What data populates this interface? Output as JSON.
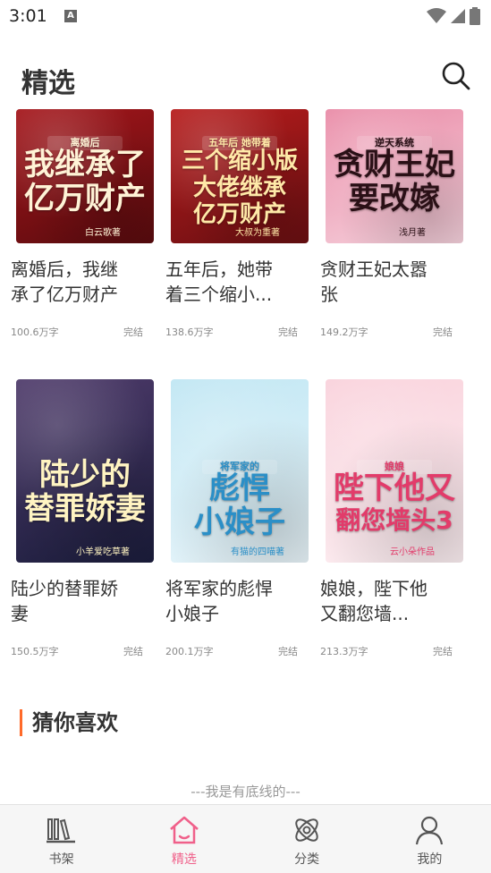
{
  "status_bar": {
    "time": "3:01",
    "notification_icon": "A"
  },
  "header": {
    "title": "精选"
  },
  "books": [
    {
      "title": "离婚后，我继承了亿万财产",
      "title_display": "离婚后，我继\n承了亿万财产",
      "words": "100.6万字",
      "status": "完结",
      "cover": {
        "tag": "离婚后",
        "line1": "我继承了",
        "line2": "亿万财产",
        "author": "白云歌著",
        "bg1": "#5a0b0e",
        "bg2": "#a5161b",
        "fg": "#fff3d6"
      }
    },
    {
      "title": "五年后，她带着三个缩小...",
      "title_display": "五年后，她带\n着三个缩小...",
      "words": "138.6万字",
      "status": "完结",
      "cover": {
        "tag": "五年后 她带着",
        "line1": "三个缩小版",
        "line2": "大佬继承",
        "line3": "亿万财产",
        "author": "大叔为重著",
        "bg1": "#6b0f12",
        "bg2": "#b71c1c",
        "fg": "#ffe9a8"
      }
    },
    {
      "title": "贪财王妃太嚣张",
      "title_display": "贪财王妃太嚣\n张",
      "words": "149.2万字",
      "status": "完结",
      "cover": {
        "tag": "逆天系统",
        "line1": "贪财王妃",
        "line2": "要改嫁",
        "author": "浅月著",
        "bg1": "#f6d2dd",
        "bg2": "#e98aa6",
        "fg": "#2a1016"
      }
    },
    {
      "title": "陆少的替罪娇妻",
      "title_display": "陆少的替罪娇\n妻",
      "words": "150.5万字",
      "status": "完结",
      "cover": {
        "tag": "",
        "line1": "陆少的",
        "line2": "替罪娇妻",
        "author": "小羊爱吃草著",
        "bg1": "#1b1d3d",
        "bg2": "#4f3b6b",
        "fg": "#fff4c2"
      }
    },
    {
      "title": "将军家的彪悍小娘子",
      "title_display": "将军家的彪悍\n小娘子",
      "words": "200.1万字",
      "status": "完结",
      "cover": {
        "tag": "将军家的",
        "line1": "彪悍",
        "line2": "小娘子",
        "author": "有猫的四喵著",
        "bg1": "#eaf6fb",
        "bg2": "#bfe6f3",
        "fg": "#2b8fc7"
      }
    },
    {
      "title": "娘娘，陛下他又翻您墙...",
      "title_display": "娘娘，陛下他\n又翻您墙...",
      "words": "213.3万字",
      "status": "完结",
      "cover": {
        "tag": "娘娘",
        "line1": "陛下他又",
        "line2": "翻您墙头3",
        "author": "云小朵作品",
        "bg1": "#fdf0f3",
        "bg2": "#f9d1db",
        "fg": "#e23b6a"
      }
    }
  ],
  "section": {
    "title": "猜你喜欢"
  },
  "footer_note": "---我是有底线的---",
  "tabs": [
    {
      "label": "书架",
      "icon": "bookshelf-icon",
      "active": false
    },
    {
      "label": "精选",
      "icon": "home-icon",
      "active": true
    },
    {
      "label": "分类",
      "icon": "category-icon",
      "active": false
    },
    {
      "label": "我的",
      "icon": "profile-icon",
      "active": false
    }
  ],
  "colors": {
    "accent": "#f0608a",
    "section_bar": "#ff6a2a",
    "muted": "#888888"
  }
}
